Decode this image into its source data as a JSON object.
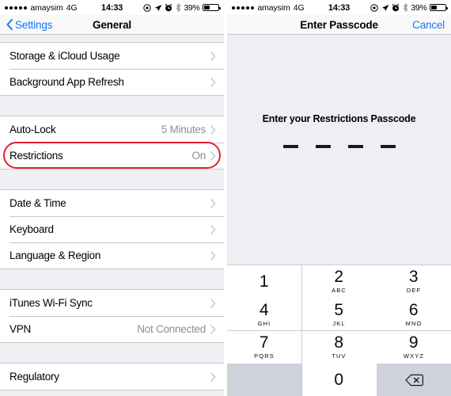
{
  "status_bar": {
    "signal_dots": 5,
    "carrier": "amaysim",
    "network": "4G",
    "time": "14:33",
    "icons": [
      "location-services-icon",
      "navigation-arrow-icon",
      "alarm-clock-icon",
      "bluetooth-icon"
    ],
    "battery_percent": "39%",
    "battery_level": 39
  },
  "left_screen": {
    "nav": {
      "back_label": "Settings",
      "title": "General"
    },
    "groups": [
      {
        "rows": [
          {
            "label": "Storage & iCloud Usage",
            "value": "",
            "chevron": true,
            "highlighted": false
          },
          {
            "label": "Background App Refresh",
            "value": "",
            "chevron": true,
            "highlighted": false
          }
        ]
      },
      {
        "rows": [
          {
            "label": "Auto-Lock",
            "value": "5 Minutes",
            "chevron": true,
            "highlighted": false
          },
          {
            "label": "Restrictions",
            "value": "On",
            "chevron": true,
            "highlighted": true
          }
        ]
      },
      {
        "rows": [
          {
            "label": "Date & Time",
            "value": "",
            "chevron": true,
            "highlighted": false
          },
          {
            "label": "Keyboard",
            "value": "",
            "chevron": true,
            "highlighted": false
          },
          {
            "label": "Language & Region",
            "value": "",
            "chevron": true,
            "highlighted": false
          }
        ]
      },
      {
        "rows": [
          {
            "label": "iTunes Wi-Fi Sync",
            "value": "",
            "chevron": true,
            "highlighted": false
          },
          {
            "label": "VPN",
            "value": "Not Connected",
            "chevron": true,
            "highlighted": false
          }
        ]
      },
      {
        "rows": [
          {
            "label": "Regulatory",
            "value": "",
            "chevron": true,
            "highlighted": false
          }
        ]
      }
    ],
    "highlight_color": "#e8202a"
  },
  "right_screen": {
    "nav": {
      "title": "Enter Passcode",
      "cancel_label": "Cancel",
      "accent_color": "#1278f3"
    },
    "prompt": "Enter your Restrictions Passcode",
    "passcode_slots": 4,
    "passcode_entered": 0,
    "keypad": [
      {
        "digit": "1",
        "letters": ""
      },
      {
        "digit": "2",
        "letters": "ABC"
      },
      {
        "digit": "3",
        "letters": "DEF"
      },
      {
        "digit": "4",
        "letters": "GHI"
      },
      {
        "digit": "5",
        "letters": "JKL"
      },
      {
        "digit": "6",
        "letters": "MNO"
      },
      {
        "digit": "7",
        "letters": "PQRS"
      },
      {
        "digit": "8",
        "letters": "TUV"
      },
      {
        "digit": "9",
        "letters": "WXYZ"
      },
      {
        "digit": "",
        "letters": "",
        "blank": true
      },
      {
        "digit": "0",
        "letters": ""
      },
      {
        "digit": "",
        "letters": "",
        "icon": "backspace-icon"
      }
    ]
  }
}
